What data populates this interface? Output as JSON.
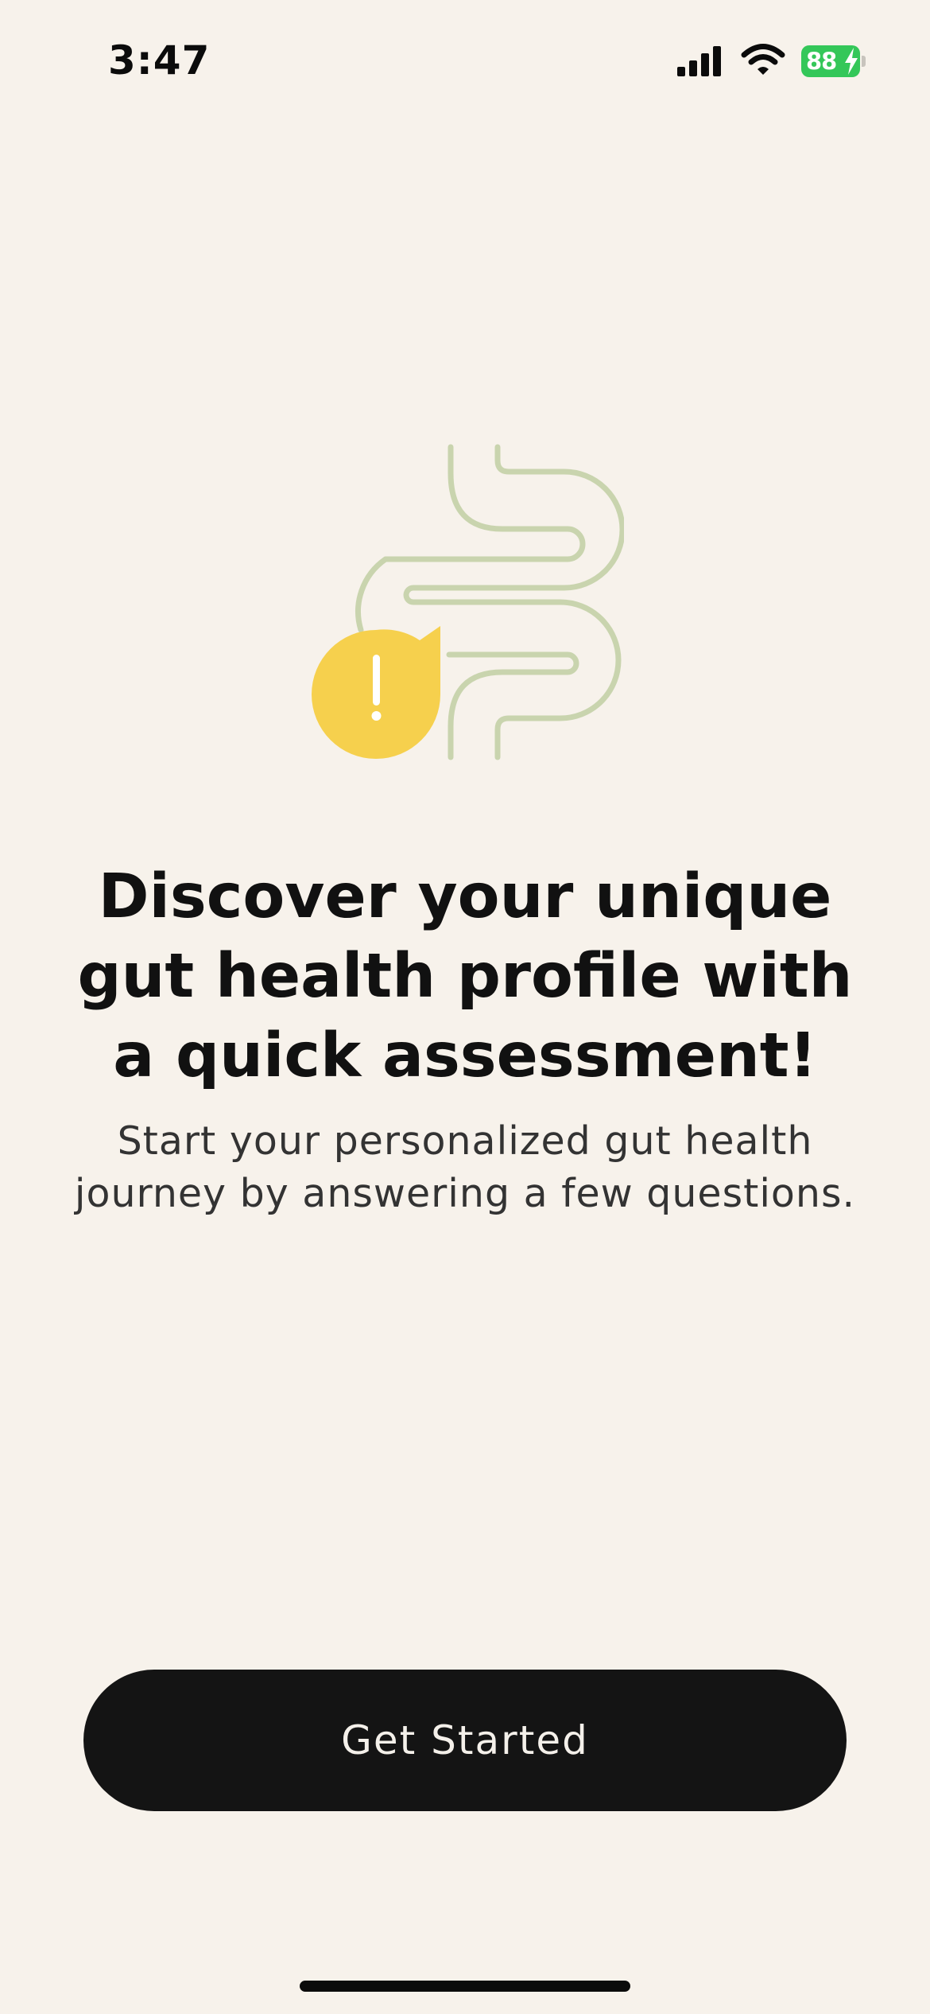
{
  "status_bar": {
    "time": "3:47",
    "battery_level": "88",
    "signal_icon": "cellular-signal-icon",
    "wifi_icon": "wifi-icon",
    "charging_icon": "charging-bolt-icon"
  },
  "illustration": {
    "icon": "intestine-alert-icon",
    "colors": {
      "intestine": "#c9d4ae",
      "alert_bubble": "#f6d04d",
      "alert_mark": "#ffffff"
    }
  },
  "onboarding": {
    "headline_lines": [
      "Discover your unique",
      "gut health profile with",
      "a quick assessment!"
    ],
    "subtitle_lines": [
      "Start your personalized gut health",
      "journey by answering a few questions."
    ],
    "cta_label": "Get Started"
  },
  "colors": {
    "background": "#f7f2eb",
    "button": "#141414",
    "button_text": "#f4f0ea",
    "battery": "#34c759"
  }
}
